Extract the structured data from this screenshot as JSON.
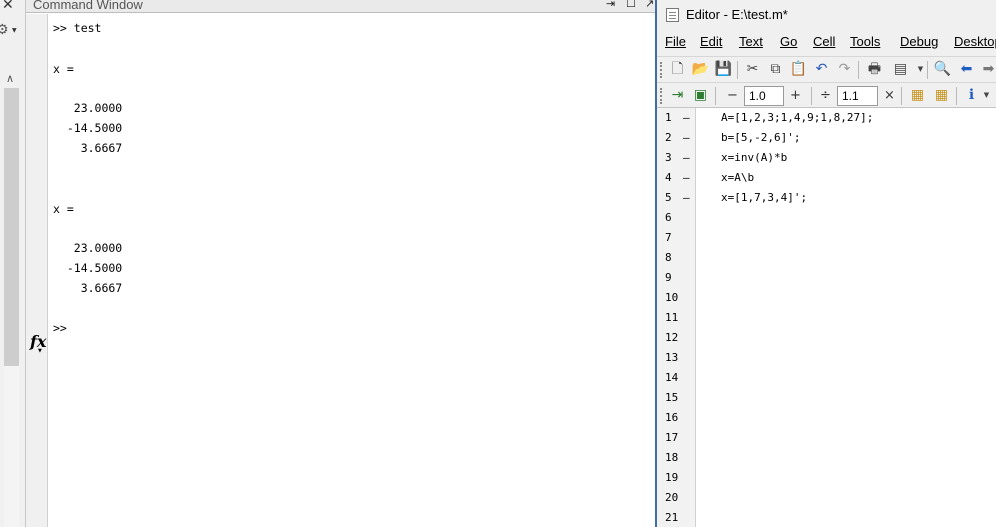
{
  "command_window": {
    "title": "Command Window",
    "lines": [
      ">> test",
      "x =",
      "   23.0000",
      "  -14.5000",
      "    3.6667",
      "x =",
      "   23.0000",
      "  -14.5000",
      "    3.6667"
    ],
    "prompt": ">>",
    "fx_label": "fx"
  },
  "editor": {
    "title": "Editor - E:\\test.m*",
    "menu": [
      "File",
      "Edit",
      "Text",
      "Go",
      "Cell",
      "Tools",
      "Debug",
      "Desktop"
    ],
    "cell_toolbar": {
      "minus": "−",
      "value1": "1.0",
      "plus": "+",
      "divide": "÷",
      "value2": "1.1",
      "times": "×"
    },
    "code_lines": [
      "A=[1,2,3;1,4,9;1,8,27];",
      "b=[5,-2,6]';",
      "x=inv(A)*b",
      "x=A\\b",
      "x=[1,7,3,4]';"
    ],
    "line_numbers": [
      "1",
      "2",
      "3",
      "4",
      "5",
      "6",
      "7",
      "8",
      "9",
      "10",
      "11",
      "12",
      "13",
      "14",
      "15",
      "16",
      "17",
      "18",
      "19",
      "20",
      "21"
    ],
    "dash": "–"
  },
  "icons": {
    "close": "close-icon",
    "gear": "gear-icon",
    "undock": "undock-icon",
    "maximize": "maximize-icon"
  }
}
